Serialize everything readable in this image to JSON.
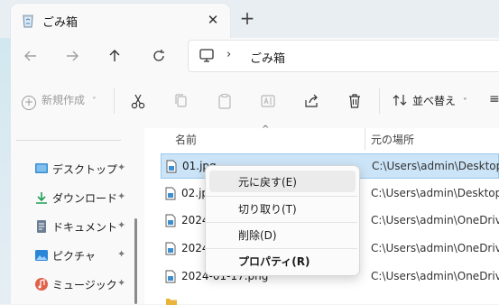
{
  "tab": {
    "title": "ごみ箱",
    "close_glyph": "✕",
    "new_tab_glyph": "+"
  },
  "address": {
    "separator": "›",
    "crumb": "ごみ箱"
  },
  "command_bar": {
    "new_label": "新規作成",
    "new_chevron": "˅",
    "sort_label": "並べ替え",
    "sort_chevron": "˅",
    "more_glyph": "≡"
  },
  "sidebar": {
    "items": [
      {
        "label": "デスクトップ",
        "icon": "desktop-icon"
      },
      {
        "label": "ダウンロード",
        "icon": "download-icon"
      },
      {
        "label": "ドキュメント",
        "icon": "documents-icon"
      },
      {
        "label": "ピクチャ",
        "icon": "pictures-icon"
      },
      {
        "label": "ミュージック",
        "icon": "music-icon"
      }
    ],
    "pin_glyph": "📌"
  },
  "columns": {
    "name": "名前",
    "original_location": "元の場所",
    "sort_glyph": "^"
  },
  "files": [
    {
      "name": "01.jpg",
      "path": "C:\\Users\\admin\\Desktop\\p"
    },
    {
      "name": "02.jpg",
      "path": "C:\\Users\\admin\\Desktop\\p"
    },
    {
      "name": "2024",
      "path": "C:\\Users\\admin\\OneDrive\\"
    },
    {
      "name": "2024",
      "path": "C:\\Users\\admin\\OneDrive\\"
    },
    {
      "name": "2024-01-17.png",
      "path": "C:\\Users\\admin\\OneDrive\\"
    }
  ],
  "context_menu": {
    "items": [
      {
        "label": "元に戻す(E)"
      },
      {
        "label": "切り取り(T)"
      },
      {
        "label": "削除(D)"
      },
      {
        "label": "プロパティ(R)"
      }
    ]
  },
  "colors": {
    "accent": "#0067c0",
    "selection": "#cce4f7",
    "folder": "#e8b53a"
  }
}
